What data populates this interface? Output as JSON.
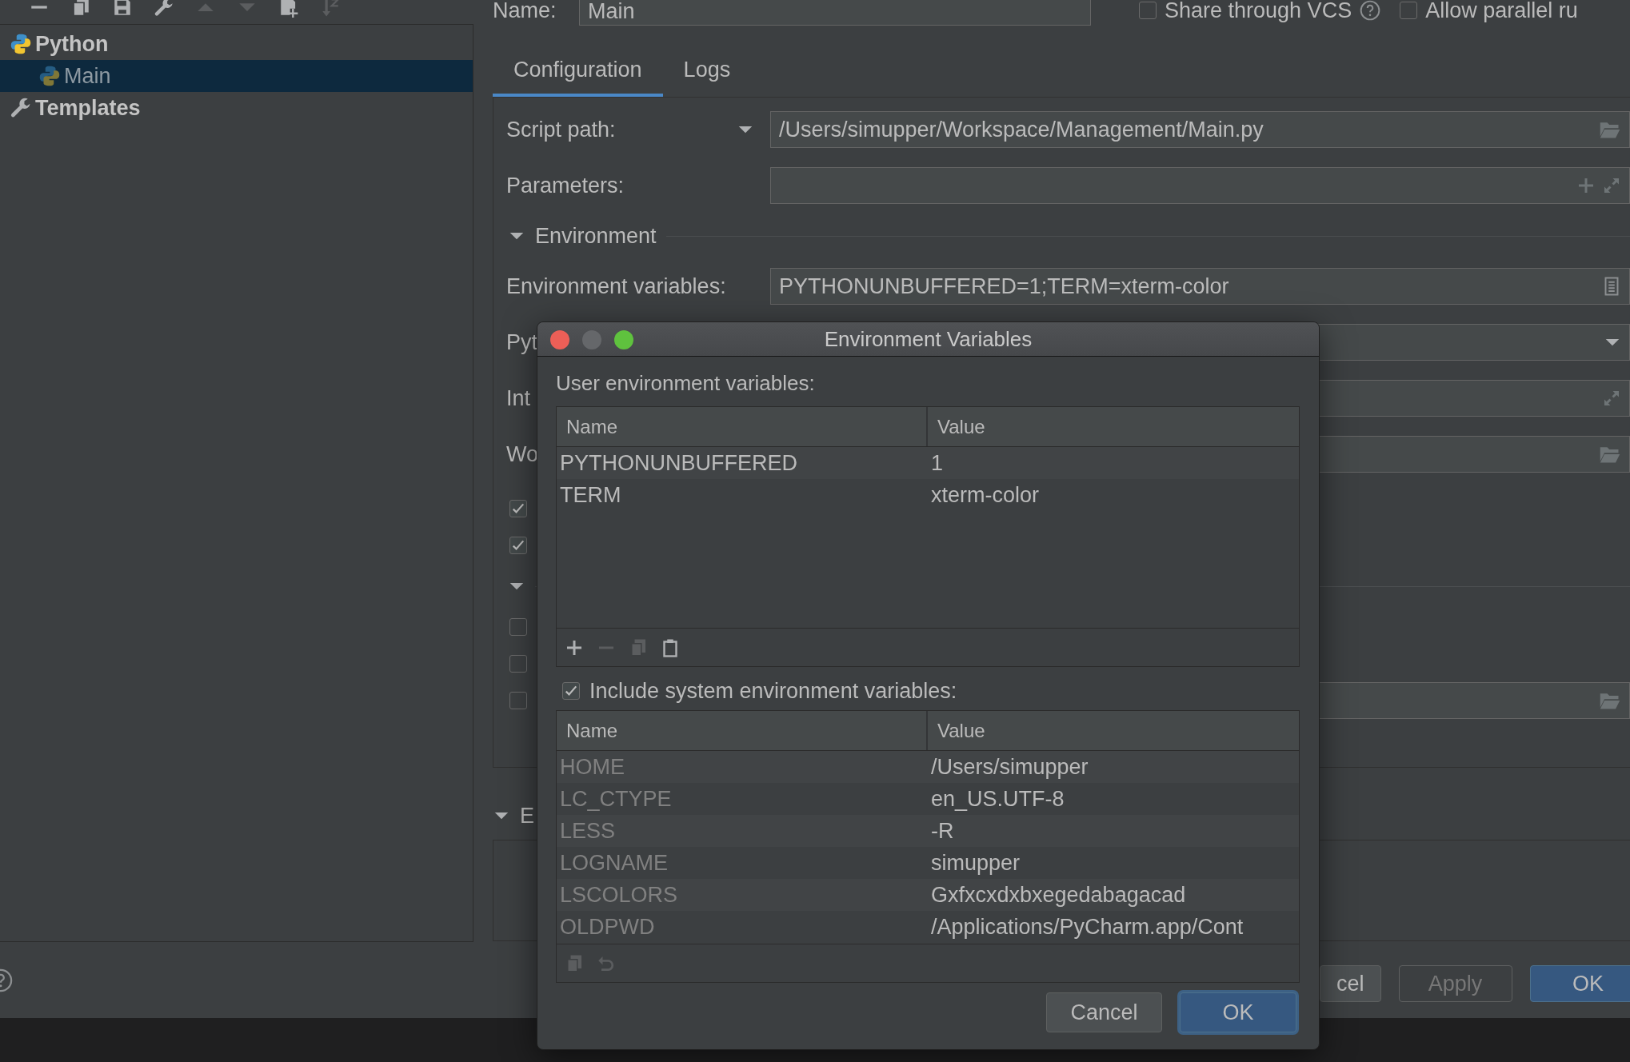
{
  "tree": [
    {
      "label": "Python",
      "kind": "python",
      "selected": false,
      "children": [
        {
          "label": "Main",
          "kind": "python",
          "selected": true
        }
      ]
    },
    {
      "label": "Templates",
      "kind": "templates",
      "selected": false
    }
  ],
  "name_field": {
    "label": "Name:",
    "value": "Main"
  },
  "options": [
    {
      "label": "Share through VCS",
      "checked": false,
      "help": true
    },
    {
      "label": "Allow parallel ru",
      "checked": false,
      "help": false
    }
  ],
  "tabs": [
    {
      "label": "Configuration",
      "selected": true
    },
    {
      "label": "Logs",
      "selected": false
    }
  ],
  "form": [
    {
      "kind": "field",
      "label": "Script path:",
      "label_menu": true,
      "value": "/Users/simupper/Workspace/Management/Main.py",
      "actions": [
        {
          "kind": "folder"
        }
      ]
    },
    {
      "kind": "field",
      "label": "Parameters:",
      "label_menu": false,
      "actions": [
        {
          "kind": "plus"
        },
        {
          "kind": "expand"
        }
      ]
    },
    {
      "kind": "section",
      "label": "Environment",
      "expanded": true
    },
    {
      "kind": "field",
      "label": "Environment variables:",
      "label_menu": false,
      "value": "PYTHONUNBUFFERED=1;TERM=xterm-color",
      "actions": [
        {
          "kind": "list"
        }
      ]
    },
    {
      "kind": "field",
      "label": "Pyt",
      "label_menu": false,
      "actions": [
        {
          "kind": "dropdown"
        }
      ]
    },
    {
      "kind": "field",
      "label": "Int",
      "label_menu": false,
      "actions": [
        {
          "kind": "expand"
        }
      ]
    },
    {
      "kind": "field",
      "label": "Wo",
      "label_menu": false,
      "actions": [
        {
          "kind": "folder"
        }
      ]
    },
    {
      "kind": "checkbox",
      "checked": true
    },
    {
      "kind": "checkbox",
      "checked": true
    },
    {
      "kind": "section",
      "expanded": true
    },
    {
      "kind": "checkbox",
      "checked": false
    },
    {
      "kind": "checkbox",
      "checked": false
    },
    {
      "kind": "checkbox",
      "checked": false,
      "actions": [
        {
          "kind": "folder"
        }
      ]
    }
  ],
  "extra_section": {
    "label": "E",
    "expanded": true
  },
  "buttons": [
    {
      "label": "cel",
      "primary": false,
      "disabled": false
    },
    {
      "label": "Apply",
      "primary": false,
      "disabled": true
    },
    {
      "label": "OK",
      "primary": true,
      "disabled": false
    }
  ],
  "dialog": {
    "title": "Environment Variables",
    "user_label": "User environment variables:",
    "user_table": {
      "columns": [
        "Name",
        "Value"
      ],
      "rows": [
        {
          "name": "PYTHONUNBUFFERED",
          "value": "1"
        },
        {
          "name": "TERM",
          "value": "xterm-color"
        }
      ]
    },
    "include_system": {
      "label": "Include system environment variables:",
      "checked": true
    },
    "system_table": {
      "columns": [
        "Name",
        "Value"
      ],
      "rows": [
        {
          "name": "HOME",
          "value": "/Users/simupper"
        },
        {
          "name": "LC_CTYPE",
          "value": "en_US.UTF-8"
        },
        {
          "name": "LESS",
          "value": "-R"
        },
        {
          "name": "LOGNAME",
          "value": "simupper"
        },
        {
          "name": "LSCOLORS",
          "value": "Gxfxcxdxbxegedabagacad"
        },
        {
          "name": "OLDPWD",
          "value": "/Applications/PyCharm.app/Cont"
        }
      ]
    },
    "buttons": [
      {
        "label": "Cancel",
        "primary": false
      },
      {
        "label": "OK",
        "primary": true
      }
    ]
  }
}
